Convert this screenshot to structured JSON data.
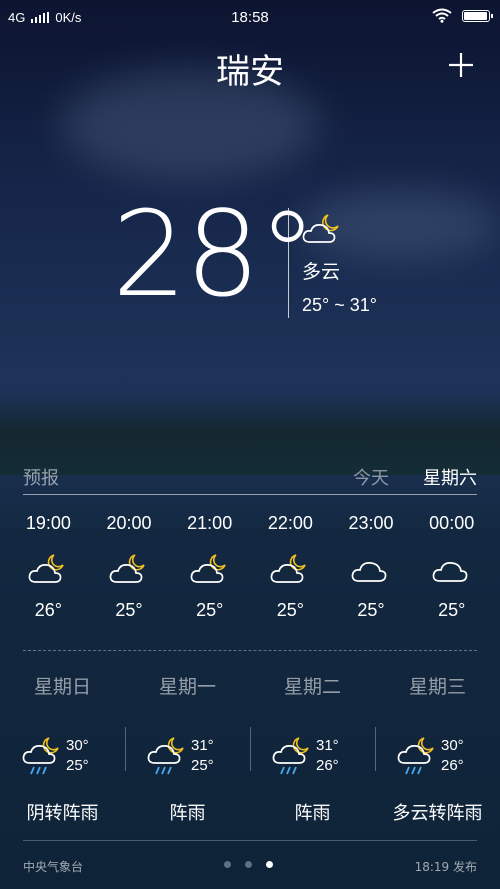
{
  "status_bar": {
    "network": "4G",
    "speed": "0K/s",
    "time": "18:58",
    "battery_level": 0.95
  },
  "header": {
    "city": "瑞安",
    "add_icon": "plus-icon"
  },
  "current": {
    "temperature": "28°",
    "condition": "多云",
    "range": "25° ~ 31°",
    "icon": "cloud-moon-icon"
  },
  "forecast_header": {
    "label": "预报",
    "today": "今天",
    "weekday": "星期六"
  },
  "hourly": [
    {
      "time": "19:00",
      "temp": "26°",
      "icon": "cloud-moon-icon"
    },
    {
      "time": "20:00",
      "temp": "25°",
      "icon": "cloud-moon-icon"
    },
    {
      "time": "21:00",
      "temp": "25°",
      "icon": "cloud-moon-icon"
    },
    {
      "time": "22:00",
      "temp": "25°",
      "icon": "cloud-moon-icon"
    },
    {
      "time": "23:00",
      "temp": "25°",
      "icon": "cloud-icon"
    },
    {
      "time": "00:00",
      "temp": "25°",
      "icon": "cloud-icon"
    }
  ],
  "daily": [
    {
      "day": "星期日",
      "high": "30°",
      "low": "25°",
      "condition": "阴转阵雨",
      "icon": "rain-moon-icon"
    },
    {
      "day": "星期一",
      "high": "31°",
      "low": "25°",
      "condition": "阵雨",
      "icon": "rain-moon-icon"
    },
    {
      "day": "星期二",
      "high": "31°",
      "low": "26°",
      "condition": "阵雨",
      "icon": "rain-moon-icon"
    },
    {
      "day": "星期三",
      "high": "30°",
      "low": "26°",
      "condition": "多云转阵雨",
      "icon": "rain-moon-icon"
    }
  ],
  "footer": {
    "source": "中央气象台",
    "published": "18:19 发布",
    "page_count": 3,
    "active_page": 3
  },
  "colors": {
    "moon": "#f0c020",
    "rain": "#4aa8f0"
  }
}
